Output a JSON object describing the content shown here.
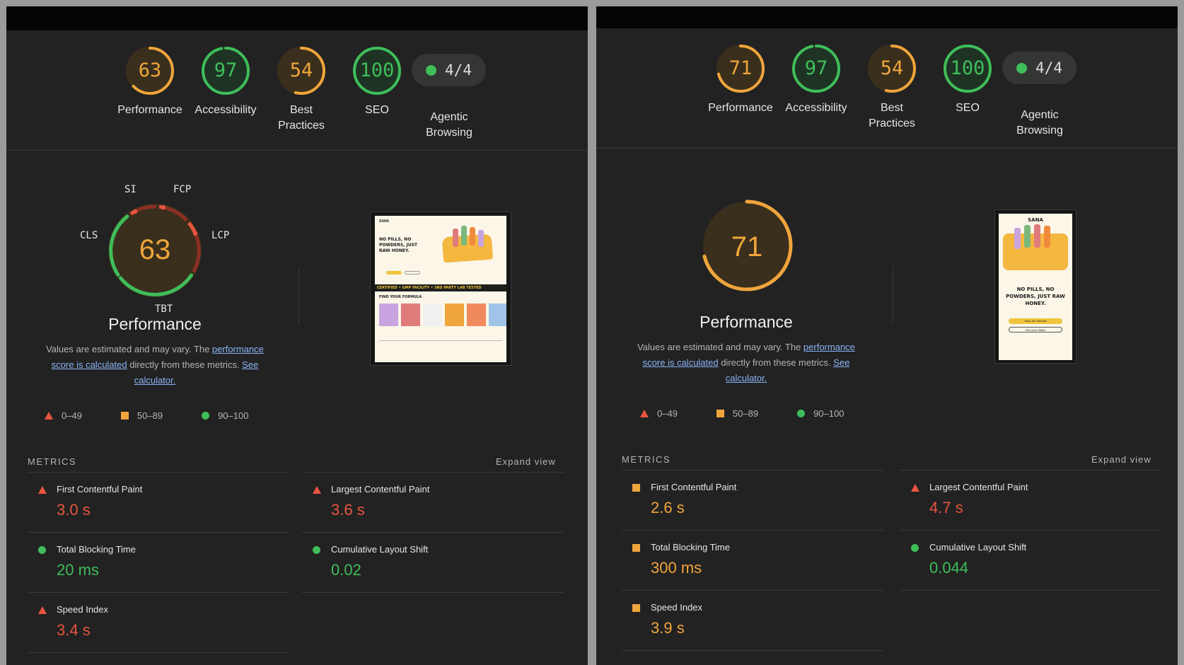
{
  "colors": {
    "fail": "#e8553f",
    "average": "#f0a53c",
    "pass": "#3fbe5a",
    "panel_bg": "#222222"
  },
  "icons": {
    "fail": "triangle-icon",
    "average": "square-icon",
    "pass": "circle-icon"
  },
  "panels": [
    {
      "id": "left",
      "scores": [
        {
          "value": "63",
          "label": "Performance",
          "status": "average",
          "fraction": 0.63
        },
        {
          "value": "97",
          "label": "Accessibility",
          "status": "pass",
          "fraction": 0.97
        },
        {
          "value": "54",
          "label": "Best Practices",
          "status": "average",
          "fraction": 0.54
        },
        {
          "value": "100",
          "label": "SEO",
          "status": "pass",
          "fraction": 1.0
        }
      ],
      "agentic": {
        "value": "4/4",
        "label": "Agentic Browsing"
      },
      "big": {
        "value": "63",
        "title": "Performance",
        "segments_shown": true,
        "tags": {
          "si": "SI",
          "fcp": "FCP",
          "cls": "CLS",
          "lcp": "LCP",
          "tbt": "TBT"
        }
      },
      "thumb_kind": "desktop",
      "metrics": [
        {
          "label": "First Contentful Paint",
          "value": "3.0 s",
          "status": "fail"
        },
        {
          "label": "Largest Contentful Paint",
          "value": "3.6 s",
          "status": "fail"
        },
        {
          "label": "Total Blocking Time",
          "value": "20 ms",
          "status": "pass"
        },
        {
          "label": "Cumulative Layout Shift",
          "value": "0.02",
          "status": "pass"
        },
        {
          "label": "Speed Index",
          "value": "3.4 s",
          "status": "fail"
        }
      ]
    },
    {
      "id": "right",
      "scores": [
        {
          "value": "71",
          "label": "Performance",
          "status": "average",
          "fraction": 0.71
        },
        {
          "value": "97",
          "label": "Accessibility",
          "status": "pass",
          "fraction": 0.97
        },
        {
          "value": "54",
          "label": "Best Practices",
          "status": "average",
          "fraction": 0.54
        },
        {
          "value": "100",
          "label": "SEO",
          "status": "pass",
          "fraction": 1.0
        }
      ],
      "agentic": {
        "value": "4/4",
        "label": "Agentic Browsing"
      },
      "big": {
        "value": "71",
        "title": "Performance",
        "segments_shown": false,
        "fraction": 0.71
      },
      "thumb_kind": "mobile",
      "metrics": [
        {
          "label": "First Contentful Paint",
          "value": "2.6 s",
          "status": "average"
        },
        {
          "label": "Largest Contentful Paint",
          "value": "4.7 s",
          "status": "fail"
        },
        {
          "label": "Total Blocking Time",
          "value": "300 ms",
          "status": "average"
        },
        {
          "label": "Cumulative Layout Shift",
          "value": "0.044",
          "status": "pass"
        },
        {
          "label": "Speed Index",
          "value": "3.9 s",
          "status": "average"
        }
      ]
    }
  ],
  "text": {
    "desc_1": "Values are estimated and may vary. The ",
    "desc_link_1": "performance score is calculated",
    "desc_2": " directly from these metrics. ",
    "desc_link_2": "See calculator.",
    "legend_fail": "0–49",
    "legend_average": "50–89",
    "legend_pass": "90–100",
    "metrics_heading": "METRICS",
    "expand_view": "Expand view"
  },
  "thumb_desktop": {
    "brand": "SANA",
    "headline": "NO PILLS, NO POWDERS, JUST RAW HONEY.",
    "banner": "CERTIFIED  •  GMP FACILITY  •  3RD PARTY LAB TESTED",
    "section": "FIND YOUR FORMULA"
  },
  "thumb_mobile": {
    "brand": "SANA",
    "headline": "NO PILLS, NO POWDERS, JUST RAW HONEY.",
    "cta_primary": "Shop the Sachets",
    "cta_secondary": "Find your Match"
  }
}
